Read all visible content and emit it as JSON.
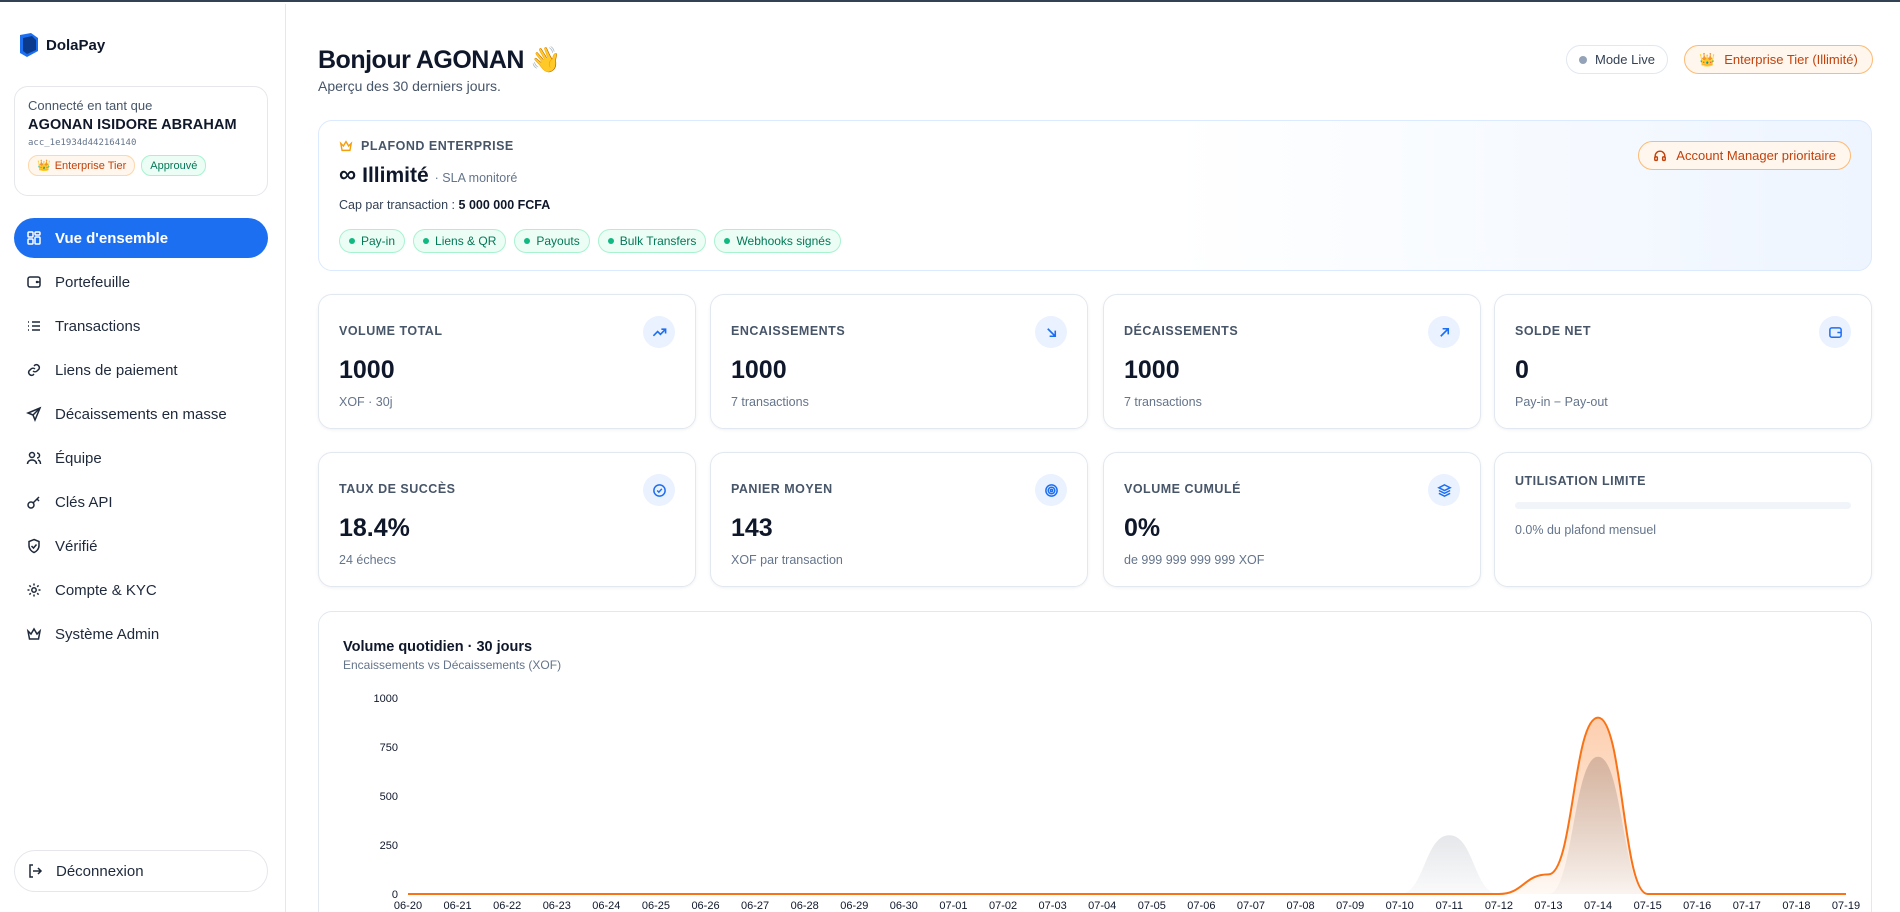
{
  "brand": {
    "name": "DolaPay"
  },
  "account": {
    "caption": "Connecté en tant que",
    "name": "AGONAN ISIDORE ABRAHAM",
    "id": "acc_1e1934d442164140",
    "tier_badge": "Enterprise Tier",
    "status_badge": "Approuvé"
  },
  "nav": [
    {
      "label": "Vue d'ensemble",
      "icon": "grid-icon",
      "active": true
    },
    {
      "label": "Portefeuille",
      "icon": "wallet-icon"
    },
    {
      "label": "Transactions",
      "icon": "list-icon"
    },
    {
      "label": "Liens de paiement",
      "icon": "link-icon"
    },
    {
      "label": "Décaissements en masse",
      "icon": "send-icon"
    },
    {
      "label": "Équipe",
      "icon": "users-icon"
    },
    {
      "label": "Clés API",
      "icon": "key-icon"
    },
    {
      "label": "Vérifié",
      "icon": "shield-icon"
    },
    {
      "label": "Compte & KYC",
      "icon": "gear-icon"
    },
    {
      "label": "Système Admin",
      "icon": "crown-icon"
    }
  ],
  "logout": {
    "label": "Déconnexion"
  },
  "header": {
    "greeting": "Bonjour AGONAN",
    "emoji": "👋",
    "subtitle": "Aperçu des 30 derniers jours.",
    "mode_label": "Mode Live",
    "tier_label": "Enterprise Tier (Illimité)"
  },
  "plafond": {
    "heading": "PLAFOND ENTERPRISE",
    "infinity": "∞",
    "title": "Illimité",
    "sla": "· SLA monitoré",
    "cap_label": "Cap par transaction :",
    "cap_value": "5 000 000 FCFA",
    "tags": [
      "Pay-in",
      "Liens & QR",
      "Payouts",
      "Bulk Transfers",
      "Webhooks signés"
    ],
    "manager_button": "Account Manager prioritaire"
  },
  "stats": [
    {
      "label": "VOLUME TOTAL",
      "value": "1000",
      "sub": "XOF · 30j",
      "icon": "trending-up-icon"
    },
    {
      "label": "ENCAISSEMENTS",
      "value": "1000",
      "sub": "7 transactions",
      "icon": "arrow-down-right-icon"
    },
    {
      "label": "DÉCAISSEMENTS",
      "value": "1000",
      "sub": "7 transactions",
      "icon": "arrow-up-right-icon"
    },
    {
      "label": "SOLDE NET",
      "value": "0",
      "sub": "Pay-in − Pay-out",
      "icon": "wallet-icon"
    },
    {
      "label": "TAUX DE SUCCÈS",
      "value": "18.4%",
      "sub": "24 échecs",
      "icon": "check-circle-icon"
    },
    {
      "label": "PANIER MOYEN",
      "value": "143",
      "sub": "XOF par transaction",
      "icon": "target-icon"
    },
    {
      "label": "VOLUME CUMULÉ",
      "value": "0%",
      "sub": "de 999 999 999 999 XOF",
      "icon": "layers-icon"
    },
    {
      "label": "UTILISATION LIMITE",
      "sub": "0.0% du plafond mensuel",
      "progress": 0.0
    }
  ],
  "colors": {
    "primary": "#1d6ff2",
    "inflow": "#f97316",
    "outflow": "#9ca3af",
    "success": "#10b981",
    "tier": "#c2410c"
  },
  "chart_data": {
    "type": "area",
    "title": "Volume quotidien · 30 jours",
    "subtitle": "Encaissements vs Décaissements (XOF)",
    "x": [
      "06-20",
      "06-21",
      "06-22",
      "06-23",
      "06-24",
      "06-25",
      "06-26",
      "06-27",
      "06-28",
      "06-29",
      "06-30",
      "07-01",
      "07-02",
      "07-03",
      "07-04",
      "07-05",
      "07-06",
      "07-07",
      "07-08",
      "07-09",
      "07-10",
      "07-11",
      "07-12",
      "07-13",
      "07-14",
      "07-15",
      "07-16",
      "07-17",
      "07-18",
      "07-19"
    ],
    "yticks": [
      0,
      250,
      500,
      750,
      1000
    ],
    "ylim": [
      0,
      1000
    ],
    "series": [
      {
        "values": [
          0,
          0,
          0,
          0,
          0,
          0,
          0,
          0,
          0,
          0,
          0,
          0,
          0,
          0,
          0,
          0,
          0,
          0,
          0,
          0,
          0,
          0,
          0,
          100,
          900,
          0,
          0,
          0,
          0,
          0
        ]
      },
      {
        "values": [
          0,
          0,
          0,
          0,
          0,
          0,
          0,
          0,
          0,
          0,
          0,
          0,
          0,
          0,
          0,
          0,
          0,
          0,
          0,
          0,
          0,
          300,
          0,
          0,
          700,
          0,
          0,
          0,
          0,
          0
        ]
      }
    ]
  }
}
